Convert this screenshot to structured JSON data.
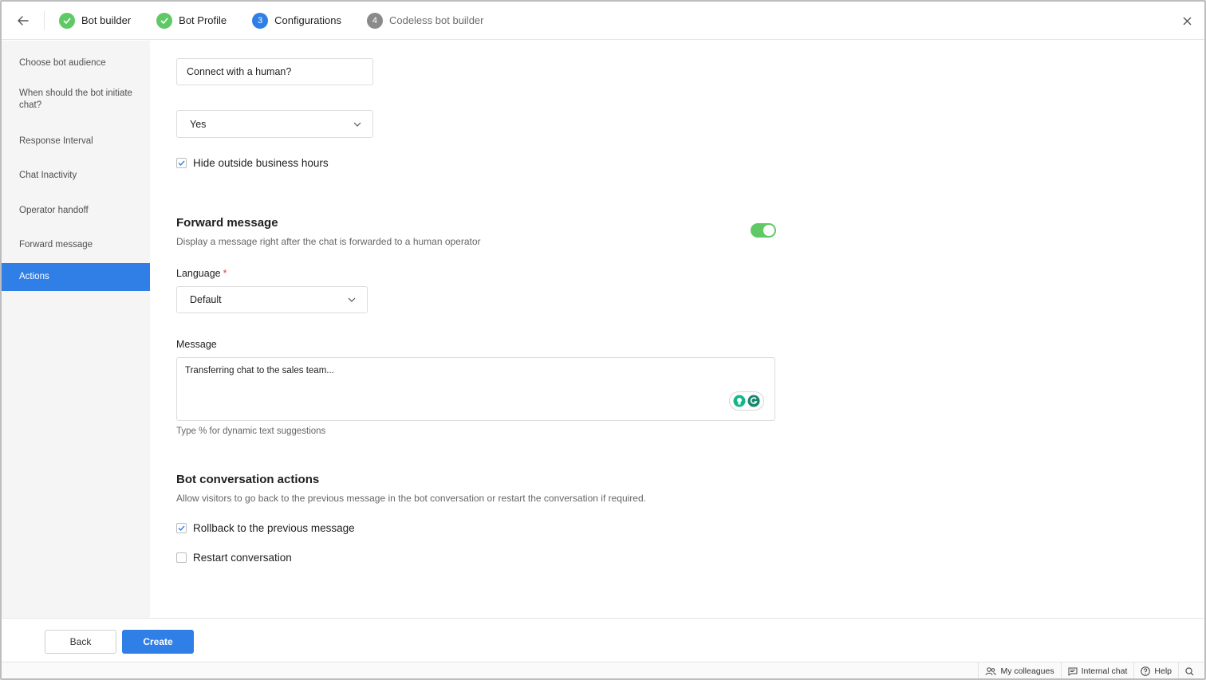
{
  "steps": [
    {
      "number": "",
      "label": "Bot builder",
      "state": "done"
    },
    {
      "number": "",
      "label": "Bot Profile",
      "state": "done"
    },
    {
      "number": "3",
      "label": "Configurations",
      "state": "active"
    },
    {
      "number": "4",
      "label": "Codeless bot builder",
      "state": "pending"
    }
  ],
  "sidebar": {
    "items": [
      {
        "label": "Choose bot audience"
      },
      {
        "label": "When should the bot initiate chat?"
      },
      {
        "label": "Response Interval"
      },
      {
        "label": "Chat Inactivity"
      },
      {
        "label": "Operator handoff"
      },
      {
        "label": "Forward message"
      },
      {
        "label": "Actions",
        "active": true
      }
    ]
  },
  "handoff": {
    "button_text_value": "Connect with a human?",
    "show_option_value": "Yes",
    "hide_outside_hours_label": "Hide outside business hours",
    "hide_outside_hours_checked": true
  },
  "forward_message": {
    "title": "Forward message",
    "description": "Display a message right after the chat is forwarded to a human operator",
    "enabled": true,
    "language_label": "Language",
    "language_required_mark": "*",
    "language_value": "Default",
    "message_label": "Message",
    "message_value": "Transferring chat to the sales team...",
    "hint": "Type % for dynamic text suggestions"
  },
  "bot_actions": {
    "title": "Bot conversation actions",
    "description": "Allow visitors to go back to the previous message in the bot conversation or restart the conversation if required.",
    "options": [
      {
        "label": "Rollback to the previous message",
        "checked": true
      },
      {
        "label": "Restart conversation",
        "checked": false
      }
    ]
  },
  "footer": {
    "back_label": "Back",
    "create_label": "Create"
  },
  "statusbar": {
    "colleagues": "My colleagues",
    "internal_chat": "Internal chat",
    "help": "Help"
  },
  "colors": {
    "accent": "#2f7fe6",
    "success": "#5fc965",
    "pending": "#8a8a8a"
  },
  "icons": [
    "back-arrow-icon",
    "check-icon",
    "close-icon",
    "chevron-down-icon",
    "grammarly-icon",
    "bulb-icon",
    "colleagues-icon",
    "chat-icon",
    "help-icon",
    "search-icon"
  ]
}
